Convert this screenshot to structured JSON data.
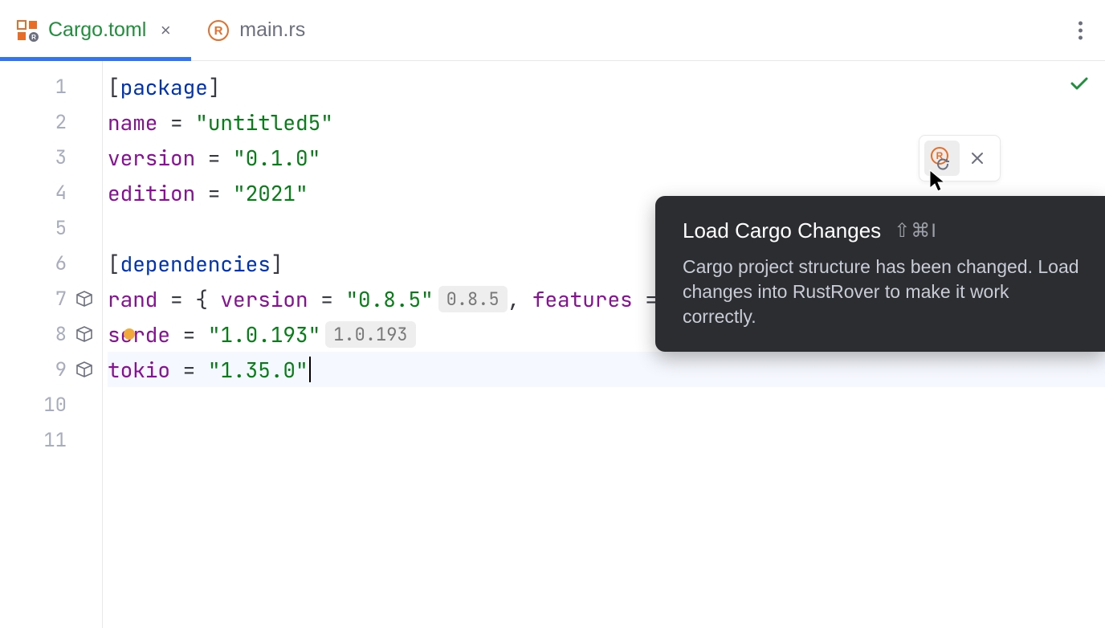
{
  "tabs": [
    {
      "label": "Cargo.toml",
      "active": true
    },
    {
      "label": "main.rs",
      "active": false
    }
  ],
  "lines": [
    "1",
    "2",
    "3",
    "4",
    "5",
    "6",
    "7",
    "8",
    "9",
    "10",
    "11"
  ],
  "code": {
    "l1": {
      "lb": "[",
      "kw": "package",
      "rb": "]"
    },
    "l2": {
      "key": "name",
      "eq": " = ",
      "val": "\"untitled5\""
    },
    "l3": {
      "key": "version",
      "eq": " = ",
      "val": "\"0.1.0\""
    },
    "l4": {
      "key": "edition",
      "eq": " = ",
      "val": "\"2021\""
    },
    "l6": {
      "lb": "[",
      "kw": "dependencies",
      "rb": "]"
    },
    "l7": {
      "key": "rand",
      "eq": " = { ",
      "vkey": "version",
      "veq": " = ",
      "val": "\"0.8.5\"",
      "hint": "0.8.5",
      "after": ", ",
      "fkey": "features",
      "feq": " ="
    },
    "l8": {
      "key": "serde",
      "eq": " = ",
      "val": "\"1.0.193\"",
      "hint": "1.0.193"
    },
    "l9": {
      "key": "tokio",
      "eq": " = ",
      "val": "\"1.35.0\""
    }
  },
  "tooltip": {
    "title": "Load Cargo Changes",
    "shortcut": "⇧⌘I",
    "body": "Cargo project structure has been changed. Load changes into RustRover to make it work correctly."
  }
}
